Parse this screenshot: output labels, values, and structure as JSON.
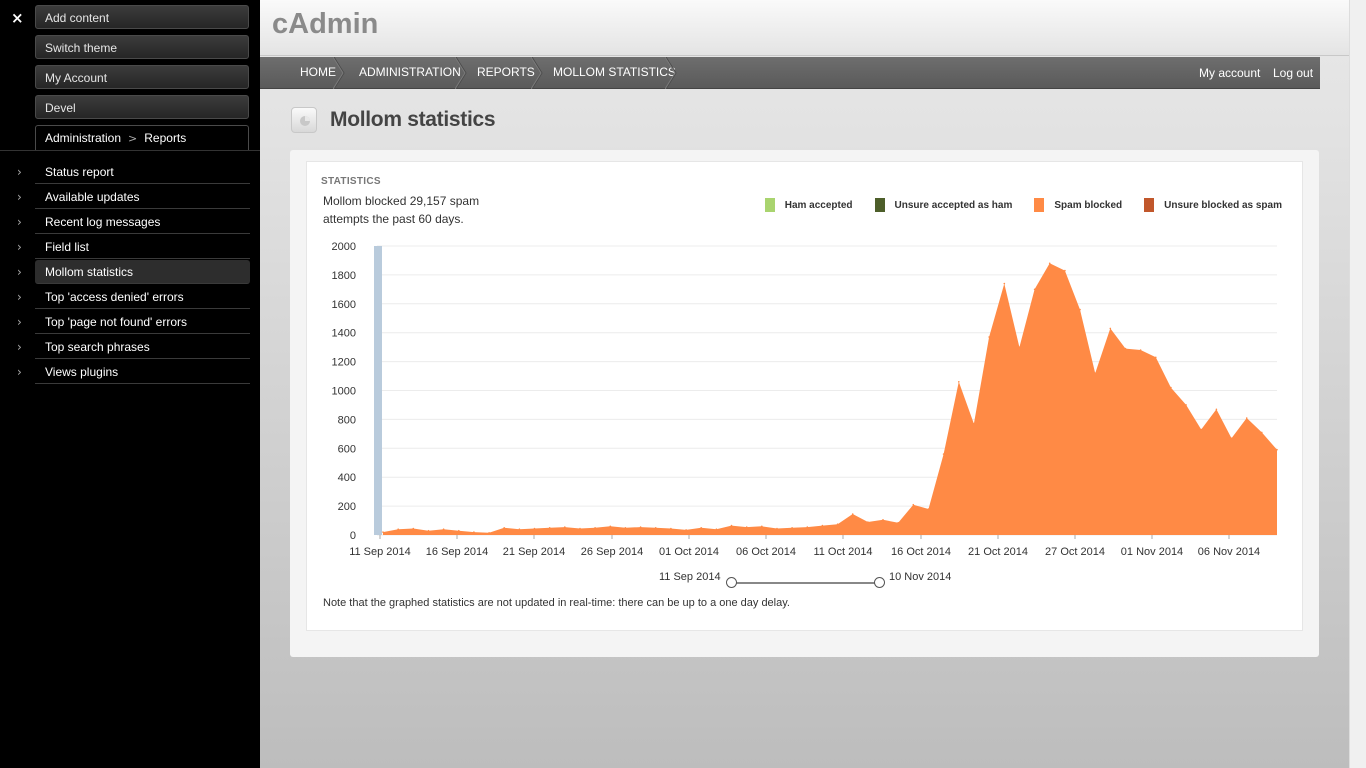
{
  "sidebar": {
    "close_glyph": "×",
    "shortcuts": [
      "Add content",
      "Switch theme",
      "My Account",
      "Devel"
    ],
    "breadcrumb": {
      "parent": "Administration",
      "current": "Reports"
    },
    "menu": [
      "Status report",
      "Available updates",
      "Recent log messages",
      "Field list",
      "Mollom statistics",
      "Top 'access denied' errors",
      "Top 'page not found' errors",
      "Top search phrases",
      "Views plugins"
    ],
    "active_item": "Mollom statistics"
  },
  "header": {
    "site_name": "cAdmin"
  },
  "navbar": {
    "breadcrumbs": [
      "HOME",
      "ADMINISTRATION",
      "REPORTS",
      "MOLLOM STATISTICS"
    ],
    "user_links": {
      "account": "My account",
      "logout": "Log out"
    }
  },
  "page": {
    "title": "Mollom statistics",
    "title_icon": "pie-chart-icon",
    "section_label": "STATISTICS",
    "summary": "Mollom blocked 29,157 spam attempts the past 60 days.",
    "note": "Note that the graphed statistics are not updated in real-time: there can be up to a one day delay.",
    "range": {
      "from": "11 Sep 2014",
      "to": "10 Nov 2014"
    }
  },
  "colors": {
    "ham_accepted": "#a9d46f",
    "unsure_accepted_as_ham": "#4d5e2a",
    "spam_blocked": "#ff8a45",
    "unsure_blocked_as_spam": "#c1572b",
    "selection_highlight": "#b9cbdc"
  },
  "chart_data": {
    "type": "area",
    "legend": [
      {
        "name": "Ham accepted",
        "color": "#a9d46f"
      },
      {
        "name": "Unsure accepted as ham",
        "color": "#4d5e2a"
      },
      {
        "name": "Spam blocked",
        "color": "#ff8a45"
      },
      {
        "name": "Unsure blocked as spam",
        "color": "#c1572b"
      }
    ],
    "legend_position": "top-right",
    "x_start": "11 Sep 2014",
    "x_end": "10 Nov 2014",
    "x_tick_labels": [
      "11 Sep 2014",
      "16 Sep 2014",
      "21 Sep 2014",
      "26 Sep 2014",
      "01 Oct 2014",
      "06 Oct 2014",
      "11 Oct 2014",
      "16 Oct 2014",
      "21 Oct 2014",
      "27 Oct 2014",
      "01 Nov 2014",
      "06 Nov 2014"
    ],
    "y_ticks": [
      0,
      200,
      400,
      600,
      800,
      1000,
      1200,
      1400,
      1600,
      1800,
      2000
    ],
    "ylim": [
      0,
      2000
    ],
    "grid": true,
    "series": [
      {
        "name": "Spam blocked",
        "values": [
          20,
          40,
          45,
          30,
          40,
          30,
          20,
          15,
          50,
          40,
          45,
          50,
          55,
          45,
          50,
          60,
          50,
          55,
          50,
          45,
          35,
          50,
          40,
          65,
          55,
          60,
          45,
          50,
          55,
          65,
          75,
          145,
          90,
          105,
          85,
          210,
          180,
          560,
          1060,
          770,
          1370,
          1740,
          1300,
          1700,
          1880,
          1830,
          1560,
          1120,
          1430,
          1290,
          1280,
          1230,
          1020,
          900,
          730,
          870,
          670,
          810,
          710,
          590
        ]
      }
    ]
  }
}
